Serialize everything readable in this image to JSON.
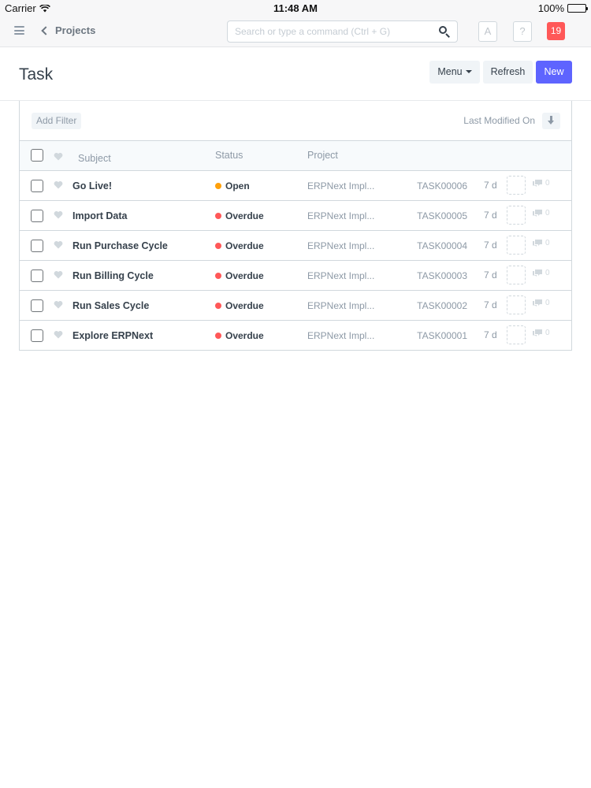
{
  "statusbar": {
    "carrier": "Carrier",
    "time": "11:48 AM",
    "battery": "100%"
  },
  "navbar": {
    "back_label": "Projects",
    "search_placeholder": "Search or type a command (Ctrl + G)",
    "avatar_letter": "A",
    "help_label": "?",
    "notification_count": "19"
  },
  "page": {
    "title": "Task",
    "menu_label": "Menu",
    "refresh_label": "Refresh",
    "new_label": "New"
  },
  "filters": {
    "add_filter_label": "Add Filter",
    "sort_label": "Last Modified On"
  },
  "columns": {
    "subject": "Subject",
    "status": "Status",
    "project": "Project"
  },
  "colors": {
    "open": "#ffa00a",
    "overdue": "#ff5858",
    "primary": "#5e64ff"
  },
  "rows": [
    {
      "subject": "Go Live!",
      "status": "Open",
      "status_color": "#ffa00a",
      "project": "ERPNext Impl...",
      "id": "TASK00006",
      "modified": "7 d",
      "comments": "0"
    },
    {
      "subject": "Import Data",
      "status": "Overdue",
      "status_color": "#ff5858",
      "project": "ERPNext Impl...",
      "id": "TASK00005",
      "modified": "7 d",
      "comments": "0"
    },
    {
      "subject": "Run Purchase Cycle",
      "status": "Overdue",
      "status_color": "#ff5858",
      "project": "ERPNext Impl...",
      "id": "TASK00004",
      "modified": "7 d",
      "comments": "0"
    },
    {
      "subject": "Run Billing Cycle",
      "status": "Overdue",
      "status_color": "#ff5858",
      "project": "ERPNext Impl...",
      "id": "TASK00003",
      "modified": "7 d",
      "comments": "0"
    },
    {
      "subject": "Run Sales Cycle",
      "status": "Overdue",
      "status_color": "#ff5858",
      "project": "ERPNext Impl...",
      "id": "TASK00002",
      "modified": "7 d",
      "comments": "0"
    },
    {
      "subject": "Explore ERPNext",
      "status": "Overdue",
      "status_color": "#ff5858",
      "project": "ERPNext Impl...",
      "id": "TASK00001",
      "modified": "7 d",
      "comments": "0"
    }
  ]
}
